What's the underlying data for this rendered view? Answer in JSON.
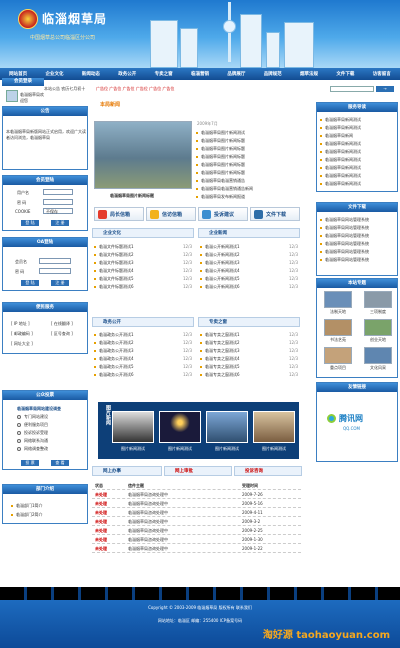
{
  "header": {
    "title": "临淄烟草局",
    "subtitle": "中国烟草总公司临淄区分公司"
  },
  "nav": [
    "网站首页",
    "企业文化",
    "新闻动态",
    "政务公开",
    "专卖之窗",
    "临淄营销",
    "品牌展厅",
    "品牌规范",
    "烟草法规",
    "文件下载",
    "访客留言"
  ],
  "ticker": {
    "date": "本站公告  农历七月初十",
    "text": "广告位 广告位 广告位 广告位 广告位 广告位"
  },
  "left": {
    "member": "会员登录",
    "member_hint": "临淄烟草局欢迎您",
    "notice_title": "公告",
    "notice_text": "本临淄烟草局新版网站正式启用，欢迎广大读者访问浏览，临淄烟草局",
    "login_title": "会员登陆",
    "user_label": "用户名",
    "pwd_label": "密 码",
    "cookie_label": "COOKIE",
    "cookie_value": "不保存",
    "login_btn": "登 陆",
    "reg_btn": "注 册",
    "oa_title": "OA登陆",
    "oa_user": "会员名",
    "oa_pwd": "密 码",
    "oa_login": "登 陆",
    "oa_reg": "注 册",
    "service_title": "便民服务",
    "services": [
      "[ IP 地址 ]",
      "[ 在线翻译 ]",
      "[ 邮政编码 ]",
      "[ 区号查询 ]",
      "[ 网址大全 ]"
    ],
    "survey_title": "公众投票",
    "survey_q": "临淄烟草局网站建设调查",
    "survey_opts": [
      "专门网站建设",
      "便利服务项目",
      "投诉投诉受理",
      "网络联系沟通",
      "网络调查整改"
    ],
    "survey_btn1": "投 票",
    "survey_btn2": "查 看",
    "dept_title": "部门介绍",
    "depts": [
      "临淄部门1简介",
      "临淄部门2简介"
    ]
  },
  "center": {
    "news_title": "本局新闻",
    "photo_caption": "临淄烟草局图片新闻标题",
    "news_date": "2009年7月",
    "news_list": [
      "临淄烟草局图片新闻测试",
      "临淄烟草局图片新闻标题",
      "临淄烟草局图片新闻标题",
      "临淄烟草局图片新闻标题",
      "临淄烟草局图片新闻标题",
      "临淄烟草局图片新闻标题",
      "临淄烟草局临淄营销通告",
      "临淄烟草局临淄营销通告新闻",
      "临淄烟草局发布新闻报道"
    ],
    "quick": [
      "局长信箱",
      "信访信箱",
      "投诉建议",
      "文件下载"
    ],
    "tabA": "企业文化",
    "tabB": "企业新闻",
    "tabC": "政务公开",
    "tabD": "专卖之窗",
    "listA": [
      "临淄文件标题测试1",
      "临淄文件标题测试2",
      "临淄文件标题测试3",
      "临淄文件标题测试4",
      "临淄文件标题测试5",
      "临淄文件标题测试6"
    ],
    "listB": [
      "临淄公开新闻测试1",
      "临淄公开新闻测试2",
      "临淄公开新闻测试3",
      "临淄公开新闻测试4",
      "临淄公开新闻测试5",
      "临淄公开新闻测试6"
    ],
    "listC": [
      "临淄政务公开测试1",
      "临淄政务公开测试2",
      "临淄政务公开测试3",
      "临淄政务公开测试4",
      "临淄政务公开测试5",
      "临淄政务公开测试6"
    ],
    "listD": [
      "临淄专卖之窗测试1",
      "临淄专卖之窗测试2",
      "临淄专卖之窗测试3",
      "临淄专卖之窗测试4",
      "临淄专卖之窗测试5",
      "临淄专卖之窗测试6"
    ],
    "dates": [
      "12/3",
      "12/3",
      "12/3",
      "12/3",
      "12/3",
      "12/3"
    ],
    "band_title": "图片新闻",
    "band_caps": [
      "图片新闻测试",
      "图片新闻测试",
      "图片新闻测试",
      "图片新闻测试"
    ],
    "online_title": "网上办事",
    "online_tab1": "网上审批",
    "online_tab2": "投诉咨询",
    "table_head": [
      "状态",
      "信件主题",
      "受理时间"
    ],
    "table_rows": [
      [
        "未处理",
        "临淄烟草局咨询处理中",
        "2009-7-26"
      ],
      [
        "未处理",
        "临淄烟草局咨询处理中",
        "2009-5-16"
      ],
      [
        "未处理",
        "临淄烟草局咨询处理中",
        "2009-4-11"
      ],
      [
        "未处理",
        "临淄烟草局咨询处理中",
        "2009-3-2"
      ],
      [
        "未处理",
        "临淄烟草局咨询处理中",
        "2009-2-25"
      ],
      [
        "未处理",
        "临淄烟草局咨询处理中",
        "2009-1-30"
      ],
      [
        "未处理",
        "临淄烟草局咨询处理中",
        "2009-1-22"
      ]
    ]
  },
  "right": {
    "guide_title": "服务导读",
    "guide": [
      "临淄烟草局新闻测试",
      "临淄烟草局新闻测试",
      "临淄烟草局新闻",
      "临淄烟草局新闻测试",
      "临淄烟草局新闻测试",
      "临淄烟草局新闻测试",
      "临淄烟草局新闻测试",
      "临淄烟草局新闻测试",
      "临淄烟草局新闻测试"
    ],
    "dl_title": "文件下载",
    "downloads": [
      "临淄烟草局网站管理系统",
      "临淄烟草局网站管理系统",
      "临淄烟草局网站管理系统",
      "临淄烟草局网站管理系统",
      "临淄烟草局网站管理系统",
      "临淄烟草局网站管理系统"
    ],
    "sites_title": "本站专题",
    "sites": [
      "法制天地",
      "三项制度",
      "书法艺苑",
      "创业天地",
      "重点项目",
      "文化风采"
    ],
    "links_title": "友情链接",
    "link_logo": "腾讯网",
    "link_sub": "QQ.COM"
  },
  "footer": {
    "copyright": "Copyright © 2003-2009  临淄烟草局  版权所有  联系我们",
    "info": "网站地址：临淄区 邮编：255400  ICP备案号码",
    "watermark": "淘好源 taohaoyuan.com"
  }
}
